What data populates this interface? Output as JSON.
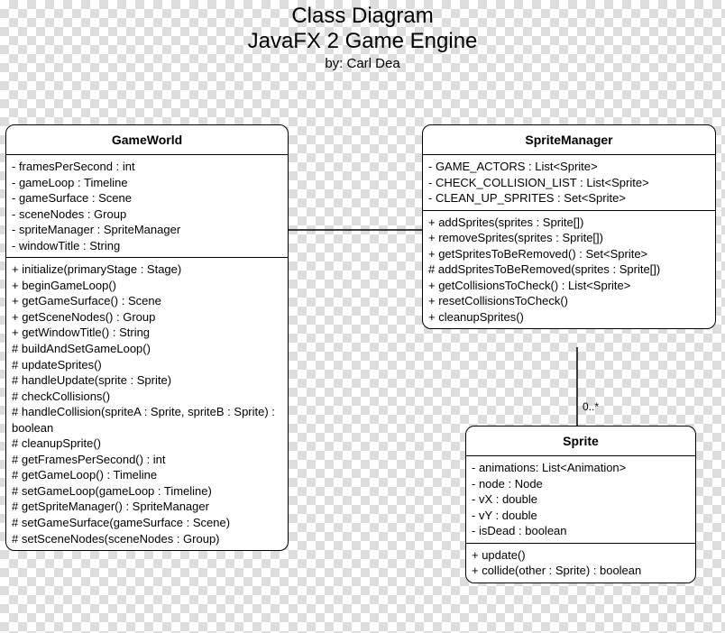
{
  "header": {
    "title": "Class Diagram",
    "subtitle": "JavaFX 2 Game Engine",
    "byline": "by: Carl Dea"
  },
  "classes": {
    "gameWorld": {
      "name": "GameWorld",
      "attributes": [
        "- framesPerSecond : int",
        "- gameLoop : Timeline",
        "- gameSurface : Scene",
        "- sceneNodes : Group",
        "- spriteManager : SpriteManager",
        "- windowTitle : String"
      ],
      "methods": [
        "+ initialize(primaryStage : Stage)",
        "+ beginGameLoop()",
        "+ getGameSurface() : Scene",
        "+ getSceneNodes() : Group",
        "+ getWindowTitle() : String",
        "# buildAndSetGameLoop()",
        "# updateSprites()",
        "# handleUpdate(sprite : Sprite)",
        "# checkCollisions()",
        "# handleCollision(spriteA : Sprite, spriteB : Sprite) : boolean",
        "# cleanupSprite()",
        "# getFramesPerSecond() : int",
        "# getGameLoop() : Timeline",
        "# setGameLoop(gameLoop : Timeline)",
        "# getSpriteManager() : SpriteManager",
        "# setGameSurface(gameSurface : Scene)",
        "# setSceneNodes(sceneNodes : Group)"
      ]
    },
    "spriteManager": {
      "name": "SpriteManager",
      "attributes": [
        "- GAME_ACTORS : List<Sprite>",
        "- CHECK_COLLISION_LIST : List<Sprite>",
        "- CLEAN_UP_SPRITES : Set<Sprite>"
      ],
      "methods": [
        "+ addSprites(sprites : Sprite[])",
        "+ removeSprites(sprites : Sprite[])",
        "+ getSpritesToBeRemoved() : Set<Sprite>",
        "# addSpritesToBeRemoved(sprites : Sprite[])",
        "+ getCollisionsToCheck() : List<Sprite>",
        "+ resetCollisionsToCheck()",
        "+ cleanupSprites()"
      ]
    },
    "sprite": {
      "name": "Sprite",
      "attributes": [
        "- animations: List<Animation>",
        "- node : Node",
        "- vX : double",
        "- vY : double",
        "- isDead : boolean"
      ],
      "methods": [
        "+ update()",
        "+ collide(other : Sprite) : boolean"
      ]
    }
  },
  "relations": {
    "spriteManager_sprite_multiplicity": "0..*"
  }
}
